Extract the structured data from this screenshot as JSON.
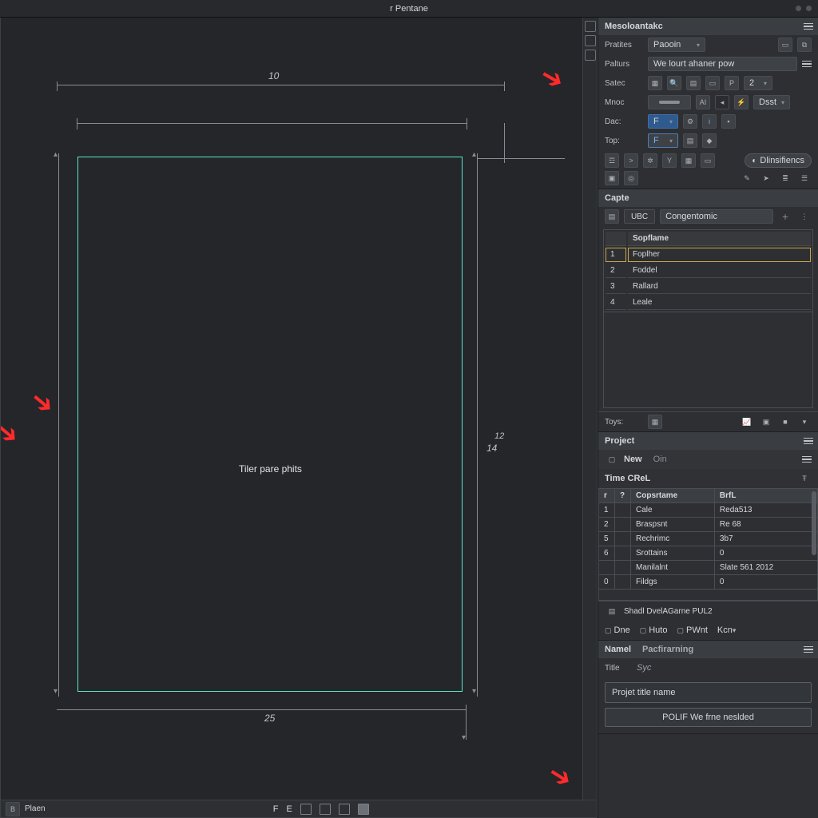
{
  "titlebar": {
    "title": "r Pentane"
  },
  "canvas": {
    "center_label": "Tiler pare phits",
    "top_dim": "10",
    "side_dim": "14",
    "right_dim": "12",
    "bottom_dim": "25"
  },
  "statusbar": {
    "left_a": "B",
    "left_b": "Plaen",
    "icons": [
      "F",
      "E",
      "⬓",
      "⬓",
      "⬓"
    ]
  },
  "panelA": {
    "title": "Mesoloantakc",
    "row1_label": "Pratites",
    "row1_value": "Paooin",
    "row2_label": "Palturs",
    "row2_value": "We lourt ahaner pow",
    "row3_label": "Satec",
    "row3_num": "2",
    "row4_label": "Mnoc",
    "row4_btn_a": "AI",
    "row4_btn_b": "Dsst",
    "row5_label": "Dac:",
    "row6_label": "Top:",
    "pill": "Dlinsifiencs",
    "icon_names": [
      "layers",
      "code",
      "gear",
      "funnel",
      "table",
      "card",
      "photo",
      "pad",
      "pencil",
      "pointer",
      "list",
      "menu"
    ]
  },
  "panelB": {
    "title": "Capte",
    "sub_a": "UBC",
    "sub_b": "Congentomic",
    "col_header": "Sopflame",
    "rows": [
      {
        "n": "1",
        "name": "Foplher"
      },
      {
        "n": "2",
        "name": "Foddel"
      },
      {
        "n": "3",
        "name": "Rallard"
      },
      {
        "n": "4",
        "name": "Leale"
      }
    ],
    "foot_label": "Toys:"
  },
  "panelC": {
    "title": "Project",
    "btn_new": "New",
    "btn_oin": "Oin",
    "subtitle": "Time CReL",
    "col_a": "Copsrtame",
    "col_b": "BrfL",
    "rows": [
      {
        "idx": "1",
        "a": "Cale",
        "b": "Reda513"
      },
      {
        "idx": "2",
        "a": "Braspsnt",
        "b": "Re 68"
      },
      {
        "idx": "5",
        "a": "Rechrimc",
        "b": "3b7"
      },
      {
        "idx": "6",
        "a": "Srottains",
        "b": "0"
      },
      {
        "idx": "",
        "a": "Manilalnt",
        "b": "Slate 561 2012"
      },
      {
        "idx": "0",
        "a": "Fildgs",
        "b": "0"
      }
    ],
    "shell_text": "Shadl DvelAGarne PUL2",
    "footer_btns": [
      "Dne",
      "Huto",
      "PWnt",
      "Kcn"
    ]
  },
  "panelD": {
    "tab_a": "Namel",
    "tab_b": "Pacfirarning",
    "title_label": "Title",
    "title_value": "Syc",
    "input_placeholder": "Projet title name",
    "button": "POLIF We frne neslded"
  }
}
